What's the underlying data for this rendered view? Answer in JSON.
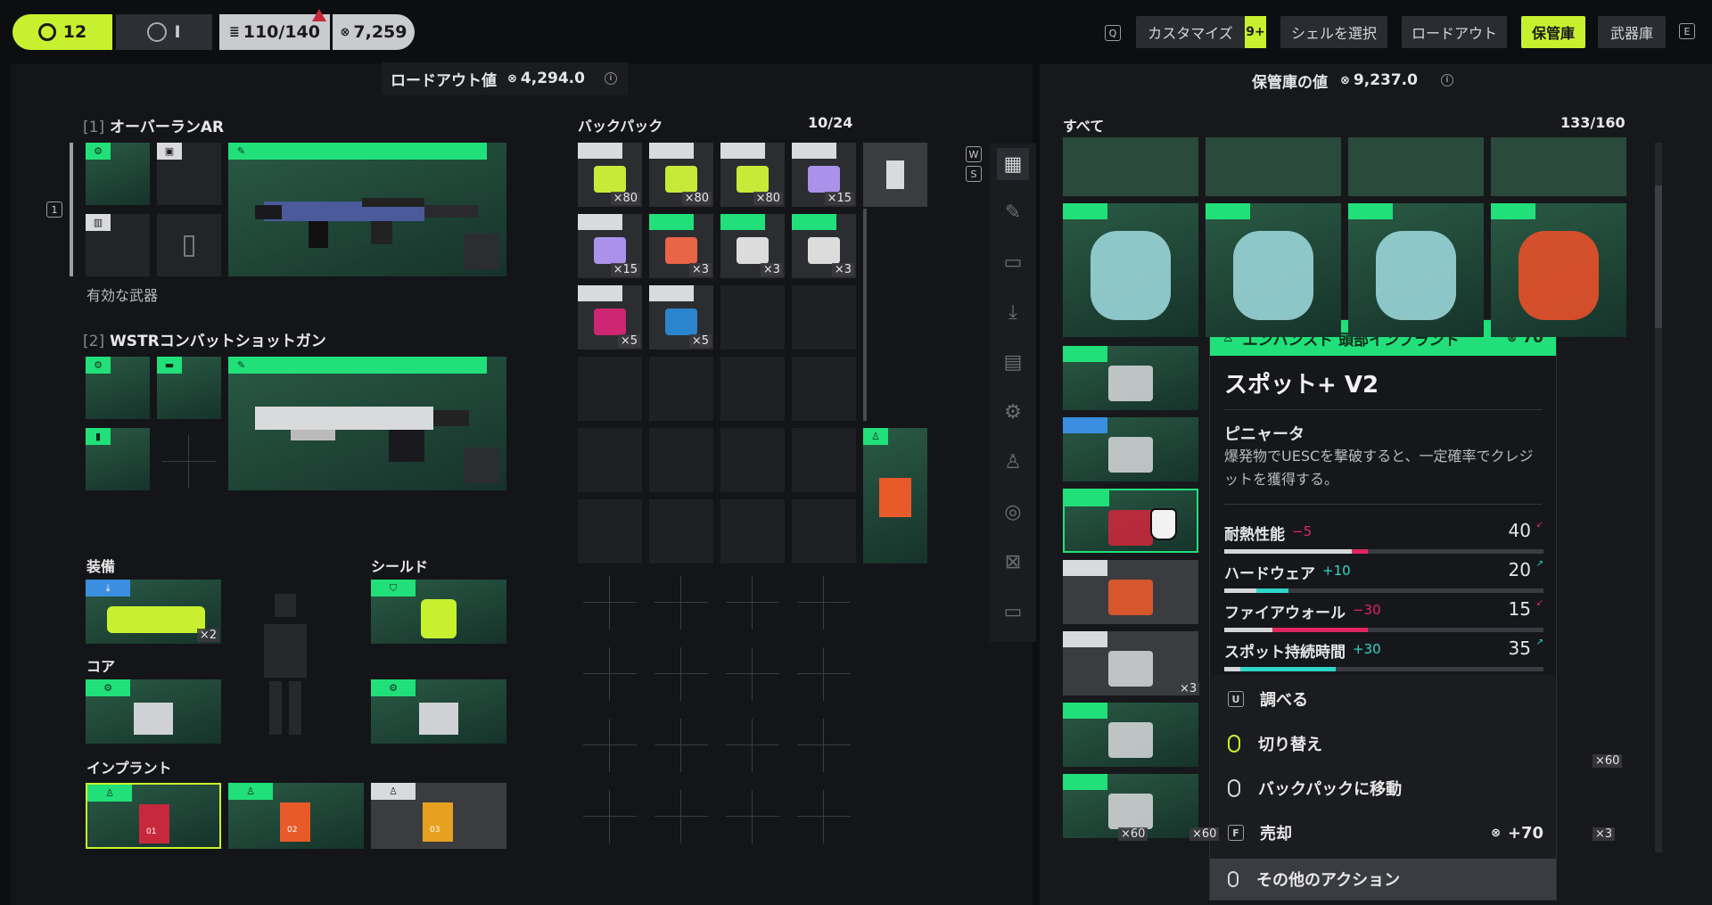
{
  "top": {
    "level": "12",
    "slot_indicator": "I",
    "capacity": "110/140",
    "credits": "7,259",
    "loadout_value_label": "ロードアウト値",
    "loadout_value": "4,294.0",
    "q_key": "Q",
    "e_key": "E",
    "tabs": [
      {
        "label": "カスタマイズ",
        "badge": "9+"
      },
      {
        "label": "シェルを選択"
      },
      {
        "label": "ロードアウト"
      },
      {
        "label": "保管庫"
      },
      {
        "label": "武器庫"
      }
    ]
  },
  "loadout": {
    "weapon1": {
      "index": "[1]",
      "name": "オーバーランAR",
      "status": "有効な武器",
      "slot_key": "1"
    },
    "weapon2": {
      "index": "[2]",
      "name": "WSTRコンバットショットガン"
    },
    "equipment_label": "装備",
    "equip_qty": "×2",
    "shield_label": "シールド",
    "core_label": "コア",
    "implant_label": "インプラント",
    "implant_levels": [
      "01",
      "02",
      "03"
    ]
  },
  "backpack": {
    "label": "バックパック",
    "count": "10/24",
    "w_key": "W",
    "s_key": "S",
    "items": [
      "×80",
      "×80",
      "×80",
      "×15",
      "×15",
      "×3",
      "×3",
      "×3",
      "×5",
      "×5"
    ]
  },
  "vault": {
    "title": "保管庫の値",
    "value": "9,237.0",
    "filter": "すべて",
    "count": "133/160",
    "qty_labels": [
      "×3",
      "×60",
      "×60",
      "×60",
      "×3"
    ]
  },
  "tooltip": {
    "category": "エンハンスド 頭部インプラント",
    "price": "70",
    "name": "スポット+ V2",
    "perk_name": "ピニャータ",
    "perk_desc": "爆発物でUESCを撃破すると、一定確率でクレジットを獲得する。",
    "stats": [
      {
        "label": "耐熱性能",
        "delta": "−5",
        "value": "40",
        "fill": 0.4,
        "delta_fill": 0.05,
        "positive": false
      },
      {
        "label": "ハードウェア",
        "delta": "+10",
        "value": "20",
        "fill": 0.2,
        "delta_fill": 0.1,
        "positive": true
      },
      {
        "label": "ファイアウォール",
        "delta": "−30",
        "value": "15",
        "fill": 0.15,
        "delta_fill": 0.3,
        "positive": false
      },
      {
        "label": "スポット持続時間",
        "delta": "+30",
        "value": "35",
        "fill": 0.35,
        "delta_fill": 0.3,
        "positive": true
      }
    ],
    "actions": [
      {
        "key": "U",
        "label": "調べる"
      },
      {
        "key": "",
        "label": "切り替え"
      },
      {
        "key": "",
        "label": "バックパックに移動"
      },
      {
        "key": "F",
        "label": "売却",
        "value": "+70"
      }
    ],
    "more": "その他のアクション"
  },
  "colors": {
    "accent": "#c7f12e",
    "green": "#21e07a",
    "red": "#e0255f",
    "cyan": "#2ed6c8"
  }
}
